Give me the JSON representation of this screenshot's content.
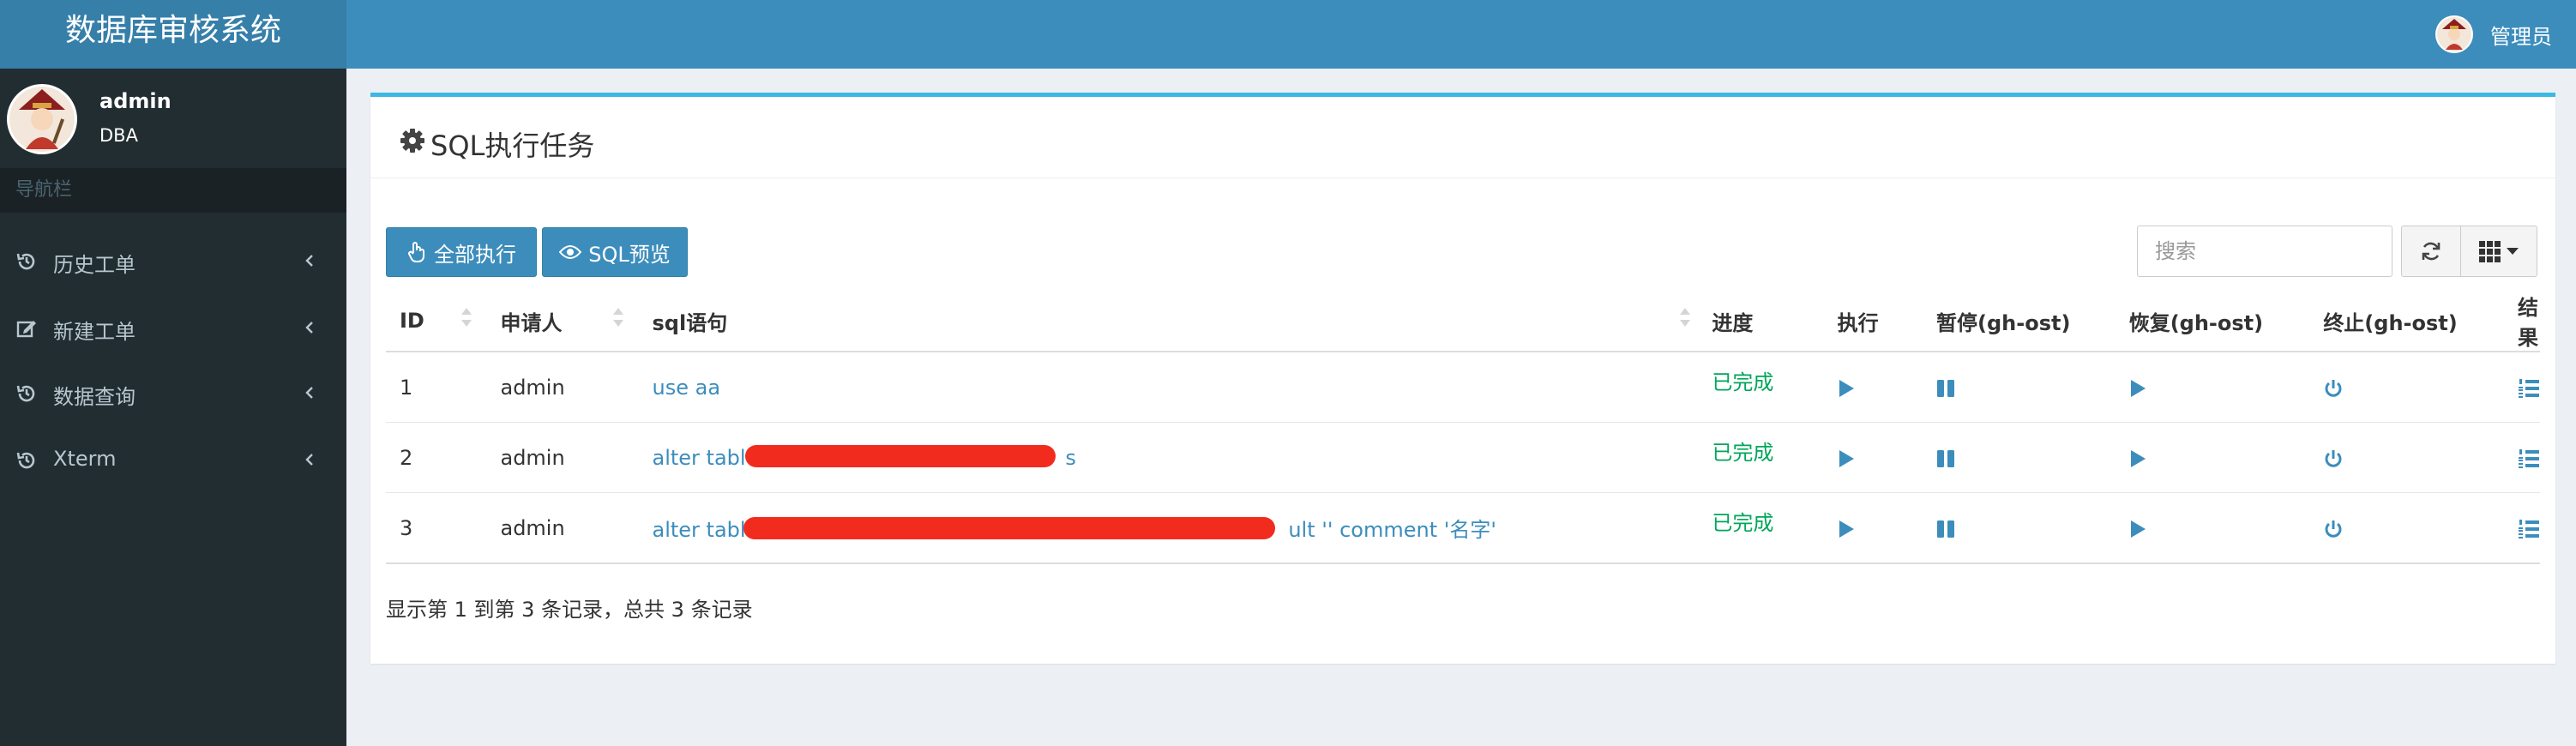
{
  "app": {
    "title": "数据库审核系统",
    "header_user": "管理员"
  },
  "sidebar": {
    "user_name": "admin",
    "user_role": "DBA",
    "nav_header": "导航栏",
    "items": [
      {
        "label": "历史工单",
        "icon": "history-icon"
      },
      {
        "label": "新建工单",
        "icon": "edit-icon"
      },
      {
        "label": "数据查询",
        "icon": "history-icon"
      },
      {
        "label": "Xterm",
        "icon": "history-icon"
      }
    ]
  },
  "panel": {
    "title": "SQL执行任务",
    "title_icon": "gear-icon",
    "buttons": {
      "run_all": "全部执行",
      "sql_preview": "SQL预览"
    },
    "search_placeholder": "搜索"
  },
  "table": {
    "columns": [
      "ID",
      "申请人",
      "sql语句",
      "进度",
      "执行",
      "暂停(gh-ost)",
      "恢复(gh-ost)",
      "终止(gh-ost)",
      "结果"
    ],
    "rows": [
      {
        "id": "1",
        "applicant": "admin",
        "sql_prefix": "use aa",
        "sql_suffix": "",
        "progress": "已完成"
      },
      {
        "id": "2",
        "applicant": "admin",
        "sql_prefix": "alter table",
        "sql_suffix": "s",
        "progress": "已完成"
      },
      {
        "id": "3",
        "applicant": "admin",
        "sql_prefix": "alter table",
        "sql_suffix": "ult '' comment '名字'",
        "progress": "已完成"
      }
    ]
  },
  "pagination_info": "显示第 1 到第 3 条记录，总共 3 条记录",
  "colors": {
    "header_bg": "#3c8dbc",
    "logo_bg": "#367fa9",
    "sidebar_bg": "#222d32",
    "accent": "#3c8dbc",
    "success": "#00a65a",
    "box_top_border": "#3cb8e4",
    "redaction": "#f22b1f"
  }
}
